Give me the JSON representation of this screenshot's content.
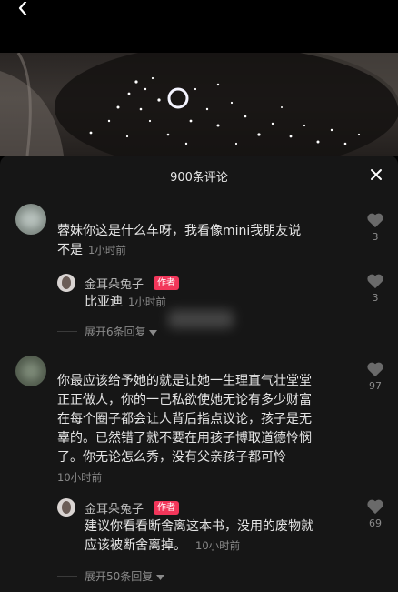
{
  "header": {
    "back_icon": "chevron-left-icon"
  },
  "sheet": {
    "title": "900条评论",
    "close_icon": "close-icon"
  },
  "comments": [
    {
      "text_line1": "蓉妹你这是什么车呀，我看像mini我朋友说",
      "text_line2": "不是",
      "time": "1小时前",
      "likes": "3",
      "reply": {
        "author": "金耳朵兔子",
        "badge": "作者",
        "text": "比亚迪",
        "time": "1小时前",
        "likes": "3"
      },
      "expand": "展开6条回复"
    },
    {
      "lines": [
        "你最应该给予她的就是让她一生理直气壮堂堂",
        "正正做人，你的一己私欲使她无论有多少财富",
        "在每个圈子都会让人背后指点议论，孩子是无",
        "辜的。已然错了就不要在用孩子博取道德怜悯",
        "了。你无论怎么秀，没有父亲孩子都可怜"
      ],
      "time": "10小时前",
      "likes": "97",
      "reply": {
        "author": "金耳朵兔子",
        "badge": "作者",
        "text_line1": "建议你看看断舍离这本书，没用的废物就",
        "text_line2": "应该被断舍离掉。",
        "time": "10小时前",
        "likes": "69"
      },
      "expand": "展开50条回复"
    }
  ],
  "colors": {
    "sheet_bg": "#161616",
    "author_badge": "#f2365a",
    "muted_text": "#8a8a8a",
    "like_icon": "#6a6a6a"
  }
}
